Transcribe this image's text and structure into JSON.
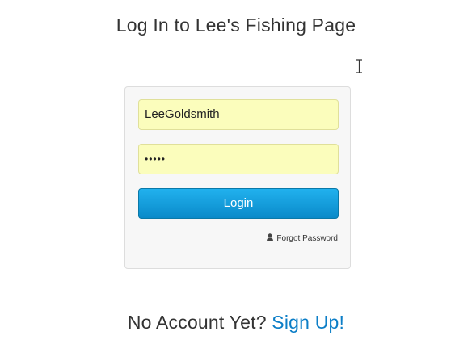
{
  "header": {
    "title": "Log In to Lee's Fishing Page"
  },
  "login_form": {
    "username_value": "LeeGoldsmith",
    "password_value": "•••••",
    "login_button_label": "Login",
    "forgot_password_label": "Forgot Password",
    "forgot_password_icon": "user-icon",
    "field_background_color": "#fbfdbc",
    "button_color": "#1aa3e3"
  },
  "footer": {
    "prompt_text": "No Account Yet?",
    "signup_label": "Sign Up!",
    "link_color": "#0c7ec7"
  }
}
